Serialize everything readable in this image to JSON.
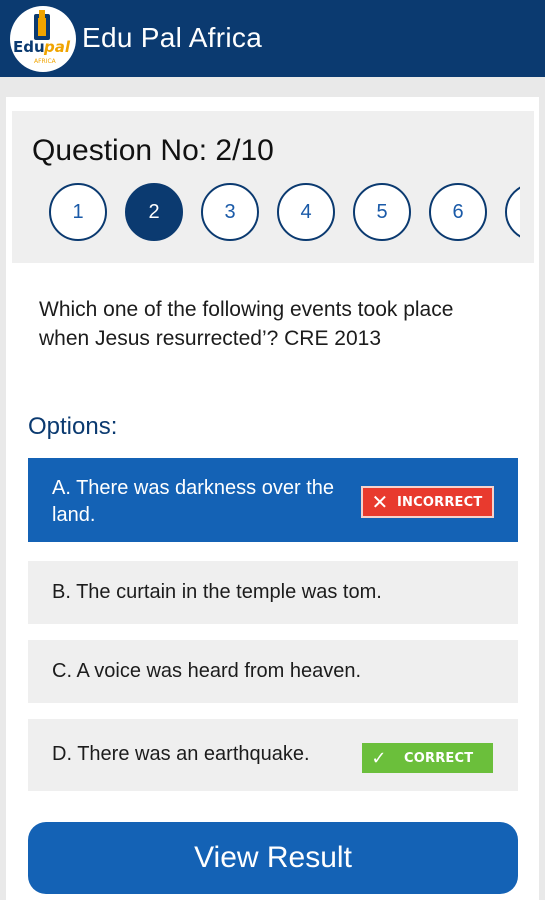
{
  "app": {
    "title": "Edu Pal Africa",
    "logo_text": "Edu pal",
    "logo_subtext": "AFRICA"
  },
  "question": {
    "number_label": "Question No: 2/10",
    "nav": [
      "1",
      "2",
      "3",
      "4",
      "5",
      "6",
      ""
    ],
    "current": 2,
    "text": "Which one of the following events took place when Jesus resurrected’? CRE 2013"
  },
  "options_label": "Options:",
  "options": [
    {
      "text": "A. There was darkness over the land.",
      "selected": true,
      "badge": "INCORRECT"
    },
    {
      "text": "B. The curtain in the temple was tom.",
      "selected": false,
      "badge": ""
    },
    {
      "text": "C. A voice was heard from heaven.",
      "selected": false,
      "badge": ""
    },
    {
      "text": "D. There was an earthquake.",
      "selected": false,
      "badge": "CORRECT"
    }
  ],
  "badges": {
    "incorrect_icon": "close-icon",
    "correct_icon": "check-icon"
  },
  "colors": {
    "appbar": "#0b3a70",
    "selected_option": "#1462b5",
    "incorrect": "#e83a2e",
    "correct": "#6bbf3b"
  },
  "view_result_label": "View Result"
}
